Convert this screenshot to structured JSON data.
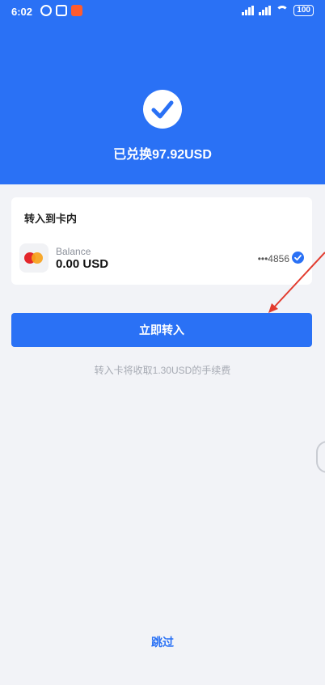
{
  "status_bar": {
    "time": "6:02",
    "battery": "100",
    "icons": [
      "alarm-icon",
      "sim-icon",
      "record-icon",
      "signal-icon",
      "wifi-icon",
      "battery-icon"
    ]
  },
  "hero": {
    "title": "已兑换97.92USD",
    "icon": "check-icon"
  },
  "card": {
    "title": "转入到卡内",
    "balance_label": "Balance",
    "balance_amount": "0.00 USD",
    "card_number": "•••4856",
    "selected": true
  },
  "actions": {
    "primary_label": "立即转入",
    "fee_note": "转入卡将收取1.30USD的手续费",
    "skip_label": "跳过"
  },
  "colors": {
    "primary": "#2a71f5",
    "background": "#f2f3f7",
    "annotation_arrow": "#e23b2e"
  }
}
